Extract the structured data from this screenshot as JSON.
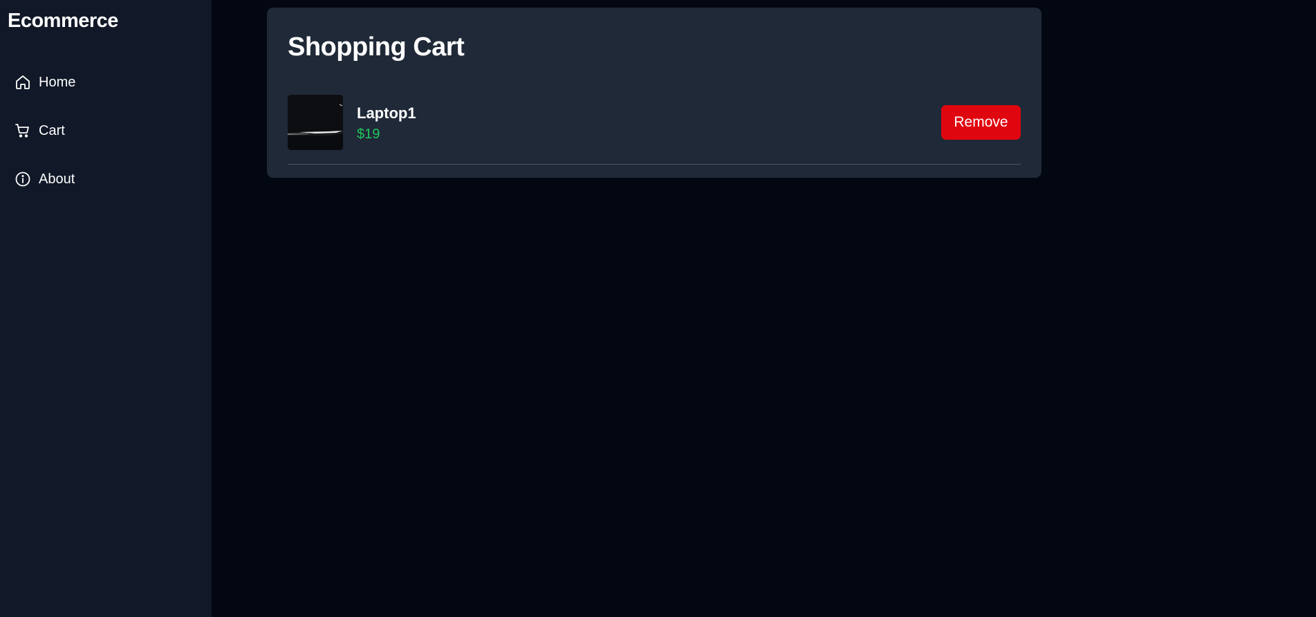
{
  "sidebar": {
    "brand": "Ecommerce",
    "items": [
      {
        "label": "Home",
        "icon": "home-icon"
      },
      {
        "label": "Cart",
        "icon": "cart-icon"
      },
      {
        "label": "About",
        "icon": "info-icon"
      }
    ]
  },
  "main": {
    "title": "Shopping Cart",
    "cart_items": [
      {
        "name": "Laptop1",
        "price": "$19",
        "remove_label": "Remove",
        "image": "laptop-thumbnail"
      }
    ]
  },
  "colors": {
    "background": "#030712",
    "sidebar": "#111827",
    "card": "#1f2937",
    "price": "#22c55e",
    "remove_button": "#e0060f"
  }
}
